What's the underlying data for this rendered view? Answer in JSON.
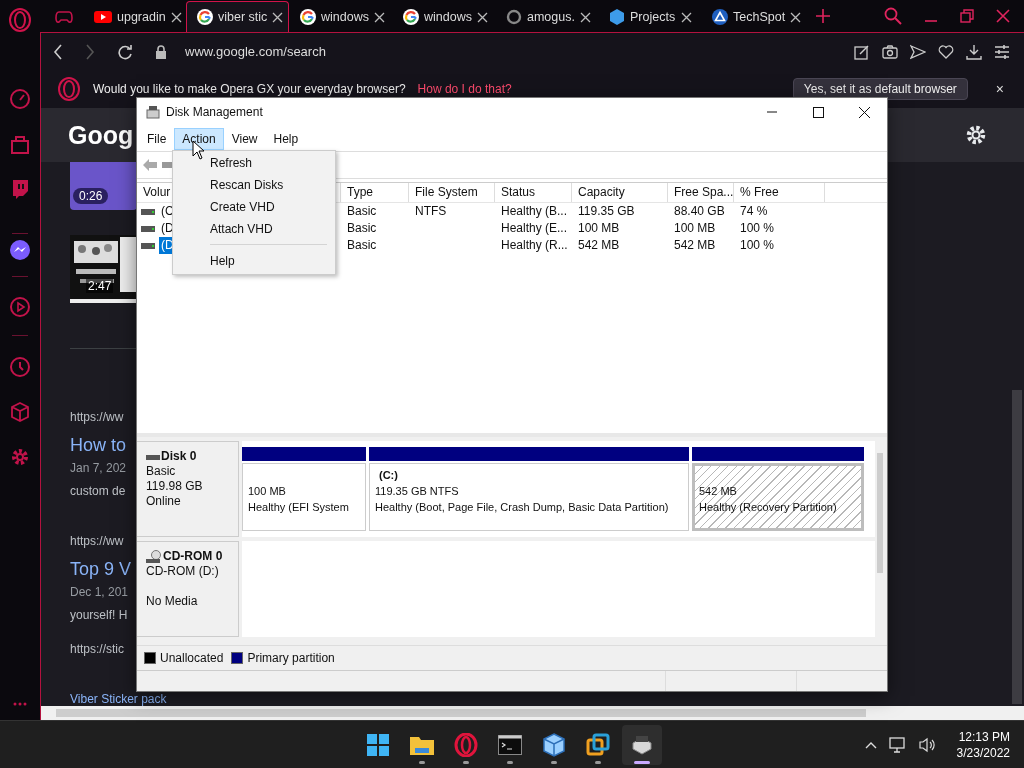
{
  "browser": {
    "tabs": [
      {
        "kind": "gamepad",
        "selected": false
      },
      {
        "kind": "youtube",
        "title": "upgradin",
        "selected": false
      },
      {
        "kind": "google",
        "title": "viber stic",
        "selected": true
      },
      {
        "kind": "google",
        "title": "windows",
        "selected": false
      },
      {
        "kind": "google",
        "title": "windows",
        "selected": false
      },
      {
        "kind": "ring",
        "title": "amogus.",
        "selected": false
      },
      {
        "kind": "cube",
        "title": "Projects",
        "selected": false
      },
      {
        "kind": "techspot",
        "title": "TechSpot",
        "selected": false
      }
    ],
    "address": "www.google.com/search",
    "banner": {
      "message": "Would you like to make Opera GX your everyday browser?",
      "link": "How do I do that?",
      "button": "Yes, set it as default browser",
      "close": "×"
    }
  },
  "page": {
    "logo": "Goog",
    "videos": [
      {
        "duration": "0:26",
        "kind": "purple"
      },
      {
        "duration": "2:47",
        "kind": "picture"
      }
    ],
    "results": [
      {
        "url": "https://ww",
        "title": "How to",
        "date": "Jan 7, 202",
        "snippet": "custom de"
      },
      {
        "url": "https://ww",
        "title": "Top 9 V",
        "date": "Dec 1, 201",
        "snippet": "yourself! H"
      },
      {
        "url": "https://stic",
        "title": "Viber Sticker pack"
      }
    ]
  },
  "disk_management": {
    "title": "Disk Management",
    "menu": [
      {
        "label": "File",
        "selected": false
      },
      {
        "label": "Action",
        "selected": true
      },
      {
        "label": "View",
        "selected": false
      },
      {
        "label": "Help",
        "selected": false
      }
    ],
    "action_menu": {
      "items": [
        "Refresh",
        "Rescan Disks",
        "Create VHD",
        "Attach VHD"
      ],
      "footer_items": [
        "Help"
      ]
    },
    "columns": [
      "Volur",
      "Type",
      "File System",
      "Status",
      "Capacity",
      "Free Spa...",
      "% Free"
    ],
    "rows": [
      {
        "volume": "(C",
        "type": "Basic",
        "fs": "NTFS",
        "status": "Healthy (B...",
        "capacity": "119.35 GB",
        "free": "88.40 GB",
        "pct": "74 %",
        "selected": false
      },
      {
        "volume": "(D",
        "type": "Basic",
        "status": "Healthy (E...",
        "capacity": "100 MB",
        "free": "100 MB",
        "pct": "100 %",
        "selected": false
      },
      {
        "volume": "(D",
        "type": "Basic",
        "status": "Healthy (R...",
        "capacity": "542 MB",
        "free": "542 MB",
        "pct": "100 %",
        "selected": true
      }
    ],
    "disks": [
      {
        "kind": "hdd",
        "name": "Disk 0",
        "type": "Basic",
        "size": "119.98 GB",
        "state": "Online",
        "partitions": [
          {
            "kind": "primary",
            "size": "100 MB",
            "status": "Healthy (EFI System",
            "selected": false
          },
          {
            "kind": "primary",
            "label": "(C:)",
            "size": "119.35 GB NTFS",
            "status": "Healthy (Boot, Page File, Crash Dump, Basic Data Partition)",
            "selected": false
          },
          {
            "kind": "recovery",
            "size": "542 MB",
            "status": "Healthy (Recovery Partition)",
            "selected": true
          }
        ]
      },
      {
        "kind": "cdrom",
        "name": "CD-ROM 0",
        "type": "CD-ROM (D:)",
        "state": "No Media"
      }
    ],
    "legend": [
      {
        "label": "Unallocated",
        "color": "#000000"
      },
      {
        "label": "Primary partition",
        "color": "#000080"
      }
    ]
  },
  "taskbar": {
    "apps": [
      {
        "kind": "start",
        "running": false,
        "selected": false
      },
      {
        "kind": "explorer",
        "running": true,
        "selected": false
      },
      {
        "kind": "opera",
        "running": true,
        "selected": false
      },
      {
        "kind": "terminal",
        "running": true,
        "selected": false
      },
      {
        "kind": "cube",
        "running": true,
        "selected": false
      },
      {
        "kind": "vmware",
        "running": true,
        "selected": false
      },
      {
        "kind": "diskmgmt",
        "running": true,
        "selected": true
      }
    ],
    "time": "12:13 PM",
    "date": "3/23/2022"
  }
}
